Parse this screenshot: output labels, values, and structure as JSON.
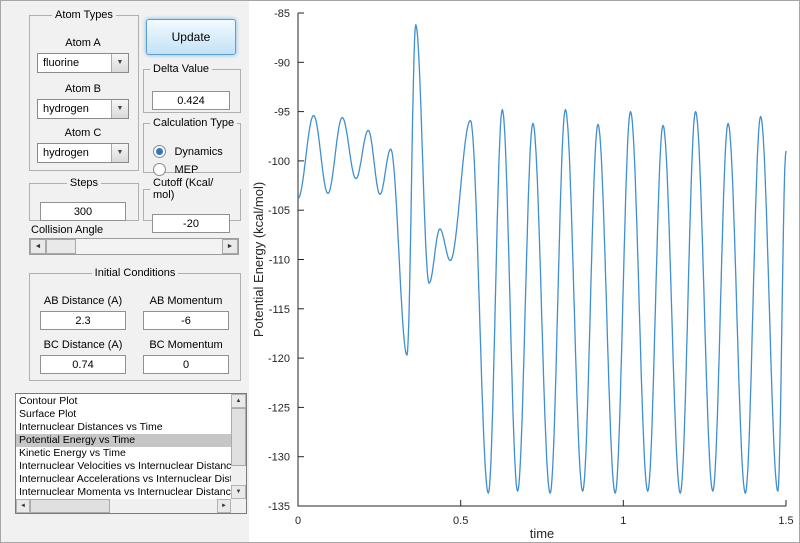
{
  "window": {
    "bg": "#f1f1f1"
  },
  "controls": {
    "update_label": "Update",
    "atom_types": {
      "title": "Atom Types",
      "fields": [
        {
          "label": "Atom A",
          "value": "fluorine"
        },
        {
          "label": "Atom B",
          "value": "hydrogen"
        },
        {
          "label": "Atom C",
          "value": "hydrogen"
        }
      ]
    },
    "delta": {
      "title": "Delta Value",
      "value": "0.424"
    },
    "calc_type": {
      "title": "Calculation Type",
      "options": [
        {
          "label": "Dynamics",
          "selected": true
        },
        {
          "label": "MEP",
          "selected": false
        }
      ]
    },
    "steps": {
      "title": "Steps",
      "value": "300"
    },
    "cutoff": {
      "title": "Cutoff (Kcal/ mol)",
      "value": "-20"
    },
    "collision_angle_label": "Collision Angle",
    "initial_conditions": {
      "title": "Initial Conditions",
      "fields": [
        {
          "label": "AB Distance (A)",
          "value": "2.3"
        },
        {
          "label": "AB Momentum",
          "value": "-6"
        },
        {
          "label": "BC Distance (A)",
          "value": "0.74"
        },
        {
          "label": "BC Momentum",
          "value": "0"
        }
      ]
    },
    "plot_list": {
      "items": [
        "Contour Plot",
        "Surface Plot",
        "Internuclear Distances vs Time",
        "Potential Energy vs Time",
        "Kinetic Energy vs Time",
        "Internuclear Velocities vs Internuclear Distance",
        "Internuclear Accelerations vs Internuclear Distance",
        "Internuclear Momenta vs Internuclear Distance"
      ],
      "selected_index": 3,
      "selected_item": "Potential Energy vs Time"
    }
  },
  "chart_data": {
    "type": "line",
    "title": "",
    "xlabel": "time",
    "ylabel": "Potential Energy (kcal/mol)",
    "xlim": [
      0,
      1.5
    ],
    "ylim": [
      -135,
      -85
    ],
    "xticks": [
      0,
      0.5,
      1,
      1.5
    ],
    "xtick_labels": [
      "0",
      "0.5",
      "1",
      "1.5"
    ],
    "yticks": [
      -135,
      -130,
      -125,
      -120,
      -115,
      -110,
      -105,
      -100,
      -95,
      -90,
      -85
    ],
    "ytick_labels": [
      "-135",
      "-130",
      "-125",
      "-120",
      "-115",
      "-110",
      "-105",
      "-100",
      "-95",
      "-90",
      "-85"
    ],
    "grid": false,
    "legend": null,
    "line_color": "#3f8fd2",
    "axis_color": "#262626",
    "series_name": "Potential Energy vs Time",
    "interpolation": "cosine-through-extrema",
    "keypoints": [
      [
        0.0,
        -103.8
      ],
      [
        0.048,
        -95.4
      ],
      [
        0.092,
        -103.3
      ],
      [
        0.136,
        -95.6
      ],
      [
        0.178,
        -101.8
      ],
      [
        0.216,
        -96.9
      ],
      [
        0.252,
        -103.4
      ],
      [
        0.285,
        -98.8
      ],
      [
        0.335,
        -119.7
      ],
      [
        0.362,
        -86.2
      ],
      [
        0.403,
        -112.4
      ],
      [
        0.436,
        -106.9
      ],
      [
        0.468,
        -110.1
      ],
      [
        0.53,
        -95.9
      ],
      [
        0.585,
        -133.7
      ],
      [
        0.628,
        -94.8
      ],
      [
        0.675,
        -133.5
      ],
      [
        0.722,
        -96.2
      ],
      [
        0.775,
        -133.7
      ],
      [
        0.822,
        -94.8
      ],
      [
        0.875,
        -133.5
      ],
      [
        0.922,
        -96.3
      ],
      [
        0.975,
        -133.7
      ],
      [
        1.022,
        -95.0
      ],
      [
        1.075,
        -133.5
      ],
      [
        1.122,
        -96.4
      ],
      [
        1.175,
        -133.7
      ],
      [
        1.222,
        -95.0
      ],
      [
        1.275,
        -133.5
      ],
      [
        1.322,
        -96.2
      ],
      [
        1.375,
        -133.7
      ],
      [
        1.422,
        -95.5
      ],
      [
        1.475,
        -133.5
      ],
      [
        1.5,
        -99.0
      ]
    ]
  }
}
